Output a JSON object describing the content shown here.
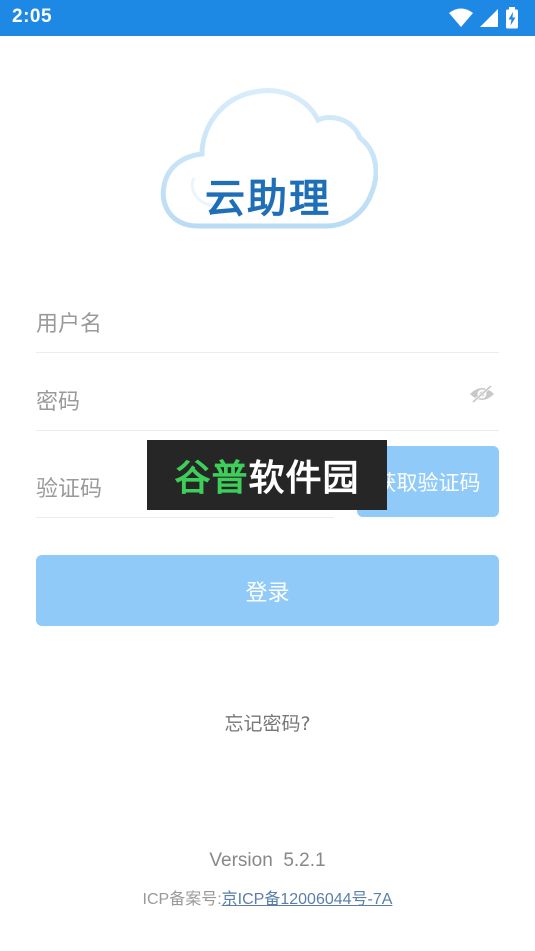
{
  "status_bar": {
    "time": "2:05",
    "background_color": "#1e88e5",
    "icons": [
      "wifi-icon",
      "signal-icon",
      "battery-charging-icon"
    ]
  },
  "logo": {
    "text": "云助理"
  },
  "form": {
    "username_placeholder": "用户名",
    "password_placeholder": "密码",
    "captcha_placeholder": "验证码",
    "get_captcha_label": "获取验证码",
    "login_label": "登录",
    "password_toggle_icon": "eye-off-icon"
  },
  "watermark": {
    "part1": "谷普",
    "part2": "软件园"
  },
  "forgot_password": "忘记密码?",
  "footer": {
    "version_label": "Version  5.2.1",
    "icp_prefix": "ICP备案号:",
    "icp_number": "京ICP备12006044号-7A"
  },
  "colors": {
    "primary": "#1e88e5",
    "button": "#90caf9",
    "logo_text": "#1e6fb8"
  }
}
